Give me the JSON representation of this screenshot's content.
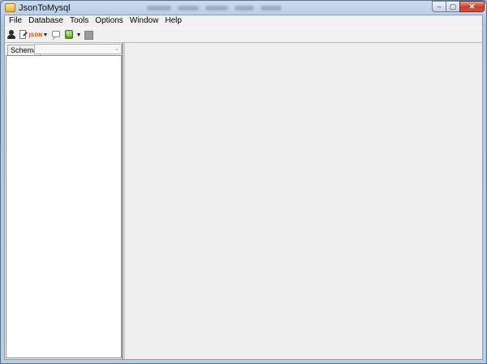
{
  "window": {
    "title": "JsonToMysql",
    "controls": {
      "minimize": "‒",
      "maximize": "▢",
      "close": "✕"
    }
  },
  "menubar": {
    "items": [
      {
        "label": "File"
      },
      {
        "label": "Database"
      },
      {
        "label": "Tools"
      },
      {
        "label": "Options"
      },
      {
        "label": "Window"
      },
      {
        "label": "Help"
      }
    ]
  },
  "toolbar": {
    "icons": [
      "user-icon",
      "edit-document-icon",
      "json-icon",
      "dropdown-arrow-icon",
      "comment-icon",
      "refresh-icon",
      "dropdown-arrow-icon",
      "stop-icon"
    ],
    "json_text": "JSON",
    "arrow_glyph": "▼",
    "refresh_glyph": "↻"
  },
  "left_panel": {
    "schema_label": "Schema",
    "schema_value": "",
    "select_caret": "⌄"
  },
  "colors": {
    "titlebar": "#c9dbef",
    "client_bg": "#f0f0f0",
    "tree_bg": "#ffffff",
    "close_button": "#c4402c",
    "json_accent": "#d9531e",
    "refresh_green": "#4c9a1e"
  }
}
